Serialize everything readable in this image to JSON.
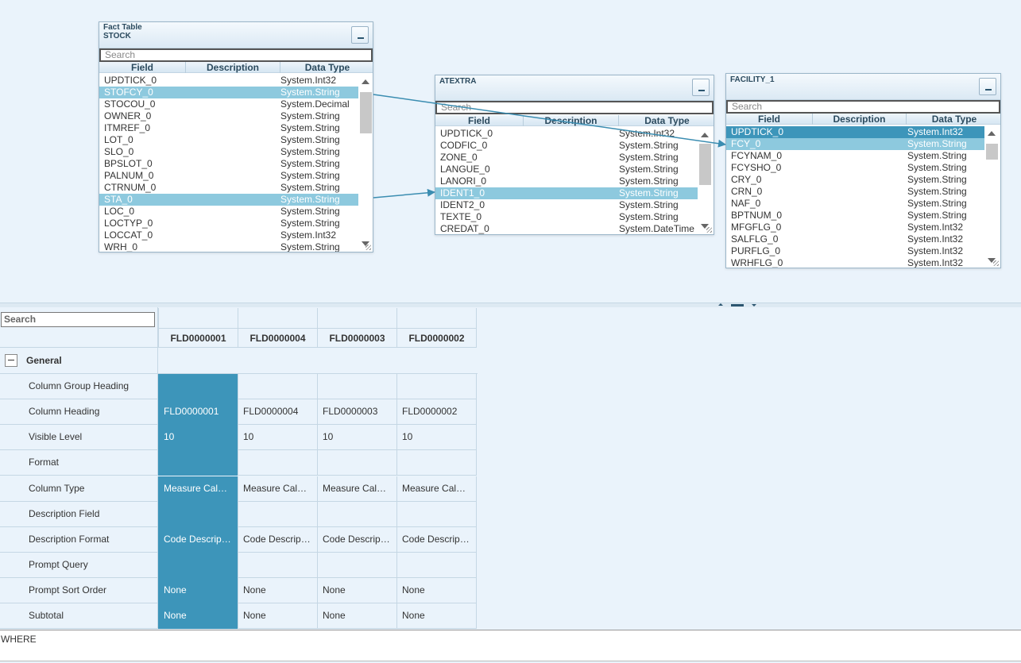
{
  "tables": {
    "stock": {
      "title_line1": "Fact Table",
      "title_line2": "STOCK",
      "search_placeholder": "Search",
      "columns": [
        "Field",
        "Description",
        "Data Type"
      ],
      "rows": [
        {
          "field": "UPDTICK_0",
          "type": "System.Int32"
        },
        {
          "field": "STOFCY_0",
          "type": "System.String"
        },
        {
          "field": "STOCOU_0",
          "type": "System.Decimal"
        },
        {
          "field": "OWNER_0",
          "type": "System.String"
        },
        {
          "field": "ITMREF_0",
          "type": "System.String"
        },
        {
          "field": "LOT_0",
          "type": "System.String"
        },
        {
          "field": "SLO_0",
          "type": "System.String"
        },
        {
          "field": "BPSLOT_0",
          "type": "System.String"
        },
        {
          "field": "PALNUM_0",
          "type": "System.String"
        },
        {
          "field": "CTRNUM_0",
          "type": "System.String"
        },
        {
          "field": "STA_0",
          "type": "System.String"
        },
        {
          "field": "LOC_0",
          "type": "System.String"
        },
        {
          "field": "LOCTYP_0",
          "type": "System.String"
        },
        {
          "field": "LOCCAT_0",
          "type": "System.Int32"
        },
        {
          "field": "WRH_0",
          "type": "System.String"
        }
      ]
    },
    "atextra": {
      "title_line1": "ATEXTRA",
      "title_line2": "",
      "search_placeholder": "Search",
      "columns": [
        "Field",
        "Description",
        "Data Type"
      ],
      "rows": [
        {
          "field": "UPDTICK_0",
          "type": "System.Int32"
        },
        {
          "field": "CODFIC_0",
          "type": "System.String"
        },
        {
          "field": "ZONE_0",
          "type": "System.String"
        },
        {
          "field": "LANGUE_0",
          "type": "System.String"
        },
        {
          "field": "LANORI_0",
          "type": "System.String"
        },
        {
          "field": "IDENT1_0",
          "type": "System.String"
        },
        {
          "field": "IDENT2_0",
          "type": "System.String"
        },
        {
          "field": "TEXTE_0",
          "type": "System.String"
        },
        {
          "field": "CREDAT_0",
          "type": "System.DateTime"
        }
      ]
    },
    "facility": {
      "title_line1": "FACILITY_1",
      "title_line2": "",
      "search_placeholder": "Search",
      "columns": [
        "Field",
        "Description",
        "Data Type"
      ],
      "rows": [
        {
          "field": "UPDTICK_0",
          "type": "System.Int32"
        },
        {
          "field": "FCY_0",
          "type": "System.String"
        },
        {
          "field": "FCYNAM_0",
          "type": "System.String"
        },
        {
          "field": "FCYSHO_0",
          "type": "System.String"
        },
        {
          "field": "CRY_0",
          "type": "System.String"
        },
        {
          "field": "CRN_0",
          "type": "System.String"
        },
        {
          "field": "NAF_0",
          "type": "System.String"
        },
        {
          "field": "BPTNUM_0",
          "type": "System.String"
        },
        {
          "field": "MFGFLG_0",
          "type": "System.Int32"
        },
        {
          "field": "SALFLG_0",
          "type": "System.Int32"
        },
        {
          "field": "PURFLG_0",
          "type": "System.Int32"
        },
        {
          "field": "WRHFLG_0",
          "type": "System.Int32"
        }
      ]
    }
  },
  "grid": {
    "search_placeholder": "Search",
    "columns": [
      "FLD0000001",
      "FLD0000004",
      "FLD0000003",
      "FLD0000002"
    ],
    "group_label": "General",
    "rows": [
      {
        "label": "Column Group Heading",
        "values": [
          "",
          "",
          "",
          ""
        ]
      },
      {
        "label": "Column Heading",
        "values": [
          "FLD0000001",
          "FLD0000004",
          "FLD0000003",
          "FLD0000002"
        ]
      },
      {
        "label": "Visible Level",
        "values": [
          "10",
          "10",
          "10",
          "10"
        ]
      },
      {
        "label": "Format",
        "values": [
          "",
          "",
          "",
          ""
        ]
      },
      {
        "label": "Column Type",
        "values": [
          "Measure Cal…",
          "Measure Cal…",
          "Measure Cal…",
          "Measure Cal…"
        ]
      },
      {
        "label": "Description Field",
        "values": [
          "",
          "",
          "",
          ""
        ]
      },
      {
        "label": "Description Format",
        "values": [
          "Code Descrip…",
          "Code Descrip…",
          "Code Descrip…",
          "Code Descrip…"
        ]
      },
      {
        "label": "Prompt Query",
        "values": [
          "",
          "",
          "",
          ""
        ]
      },
      {
        "label": "Prompt Sort Order",
        "values": [
          "None",
          "None",
          "None",
          "None"
        ]
      },
      {
        "label": "Subtotal",
        "values": [
          "None",
          "None",
          "None",
          "None"
        ]
      }
    ]
  },
  "where_label": "WHERE",
  "colors": {
    "background": "#eaf3fb",
    "row_selected": "#8dc9de",
    "row_selected_strong": "#3d95ba",
    "link_line": "#3b8db1"
  }
}
